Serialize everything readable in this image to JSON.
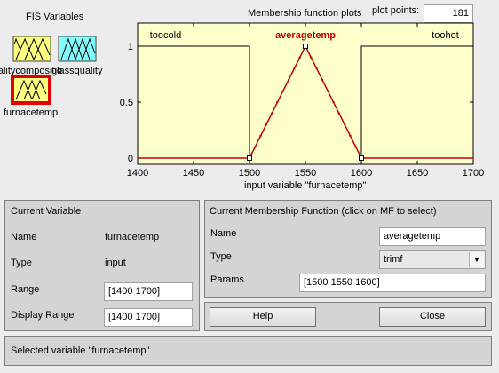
{
  "fis_variables": {
    "title": "FIS Variables",
    "items": [
      {
        "label": "qualitycompositio",
        "color": "#ffff80"
      },
      {
        "label": "glassquality",
        "color": "#80ffff"
      },
      {
        "label": "furnacetemp",
        "color": "#ffff80",
        "selected": true
      }
    ],
    "selected_border_color": "#e00000"
  },
  "plot": {
    "title": "Membership function plots",
    "plot_points_label": "plot points:",
    "plot_points_value": "181",
    "xlabel": "input variable \"furnacetemp\"",
    "x_ticks": [
      "1400",
      "1450",
      "1500",
      "1550",
      "1600",
      "1650",
      "1700"
    ],
    "y_ticks": [
      "0",
      "0.5",
      "1"
    ],
    "background": "#ffffcc",
    "selected_color": "#c00000",
    "normal_color": "#000000"
  },
  "chart_data": {
    "type": "line",
    "xlim": [
      1400,
      1700
    ],
    "ylim": [
      0,
      1
    ],
    "x_ticks": [
      1400,
      1450,
      1500,
      1550,
      1600,
      1650,
      1700
    ],
    "y_ticks": [
      0,
      0.5,
      1
    ],
    "series": [
      {
        "name": "toocold",
        "x": [
          1400,
          1500,
          1500
        ],
        "y": [
          1,
          1,
          0
        ],
        "selected": false
      },
      {
        "name": "averagetemp",
        "x": [
          1400,
          1500,
          1550,
          1600,
          1700
        ],
        "y": [
          0,
          0,
          1,
          0,
          0
        ],
        "selected": true
      },
      {
        "name": "toohot",
        "x": [
          1600,
          1600,
          1700
        ],
        "y": [
          0,
          1,
          1
        ],
        "selected": false
      }
    ],
    "mf_labels": [
      {
        "text": "toocold",
        "x": 1425
      },
      {
        "text": "averagetemp",
        "x": 1550
      },
      {
        "text": "toohot",
        "x": 1675
      }
    ]
  },
  "current_variable": {
    "header": "Current Variable",
    "name_label": "Name",
    "name_value": "furnacetemp",
    "type_label": "Type",
    "type_value": "input",
    "range_label": "Range",
    "range_value": "[1400 1700]",
    "display_range_label": "Display Range",
    "display_range_value": "[1400 1700]"
  },
  "current_mf": {
    "header": "Current Membership Function (click on MF to select)",
    "name_label": "Name",
    "name_value": "averagetemp",
    "type_label": "Type",
    "type_value": "trimf",
    "params_label": "Params",
    "params_value": "[1500 1550 1600]"
  },
  "buttons": {
    "help": "Help",
    "close": "Close"
  },
  "status": {
    "text": "Selected variable \"furnacetemp\""
  }
}
